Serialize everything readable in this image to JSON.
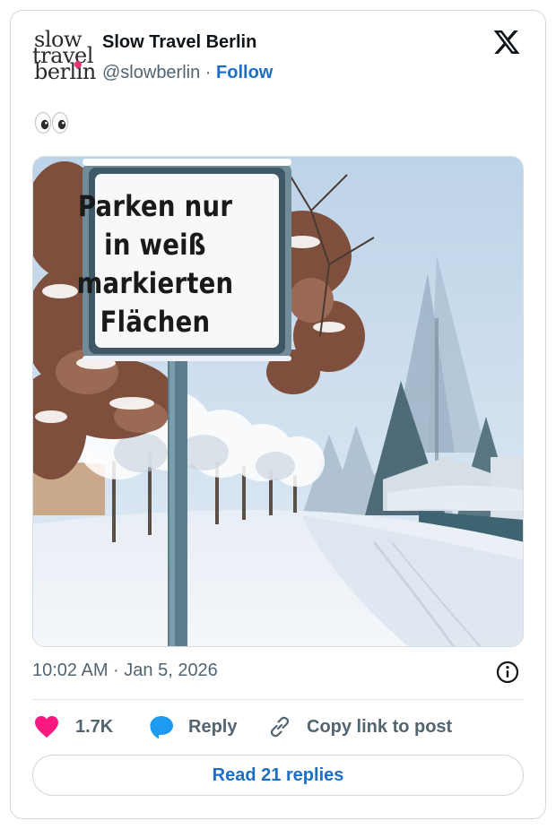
{
  "author": {
    "logo_lines": [
      "slow",
      "travel",
      "berlin"
    ],
    "name": "Slow Travel Berlin",
    "handle": "@slowberlin",
    "separator": " · ",
    "follow_label": "Follow"
  },
  "post": {
    "text_icon": "eyes-emoji",
    "image": {
      "sign_lines": [
        "Parken nur",
        "in weiß",
        "markierten",
        "Flächen"
      ]
    },
    "timestamp": "10:02 AM · Jan 5, 2026"
  },
  "actions": {
    "like_count": "1.7K",
    "reply_label": "Reply",
    "copy_label": "Copy link to post",
    "read_replies_label": "Read 21 replies"
  },
  "colors": {
    "accent": "#1d6fc4",
    "heart": "#f91880",
    "reply_bubble": "#1d9bf0",
    "muted": "#536471"
  },
  "icons": [
    "x-logo-icon",
    "info-icon",
    "heart-icon",
    "reply-icon",
    "link-icon"
  ]
}
